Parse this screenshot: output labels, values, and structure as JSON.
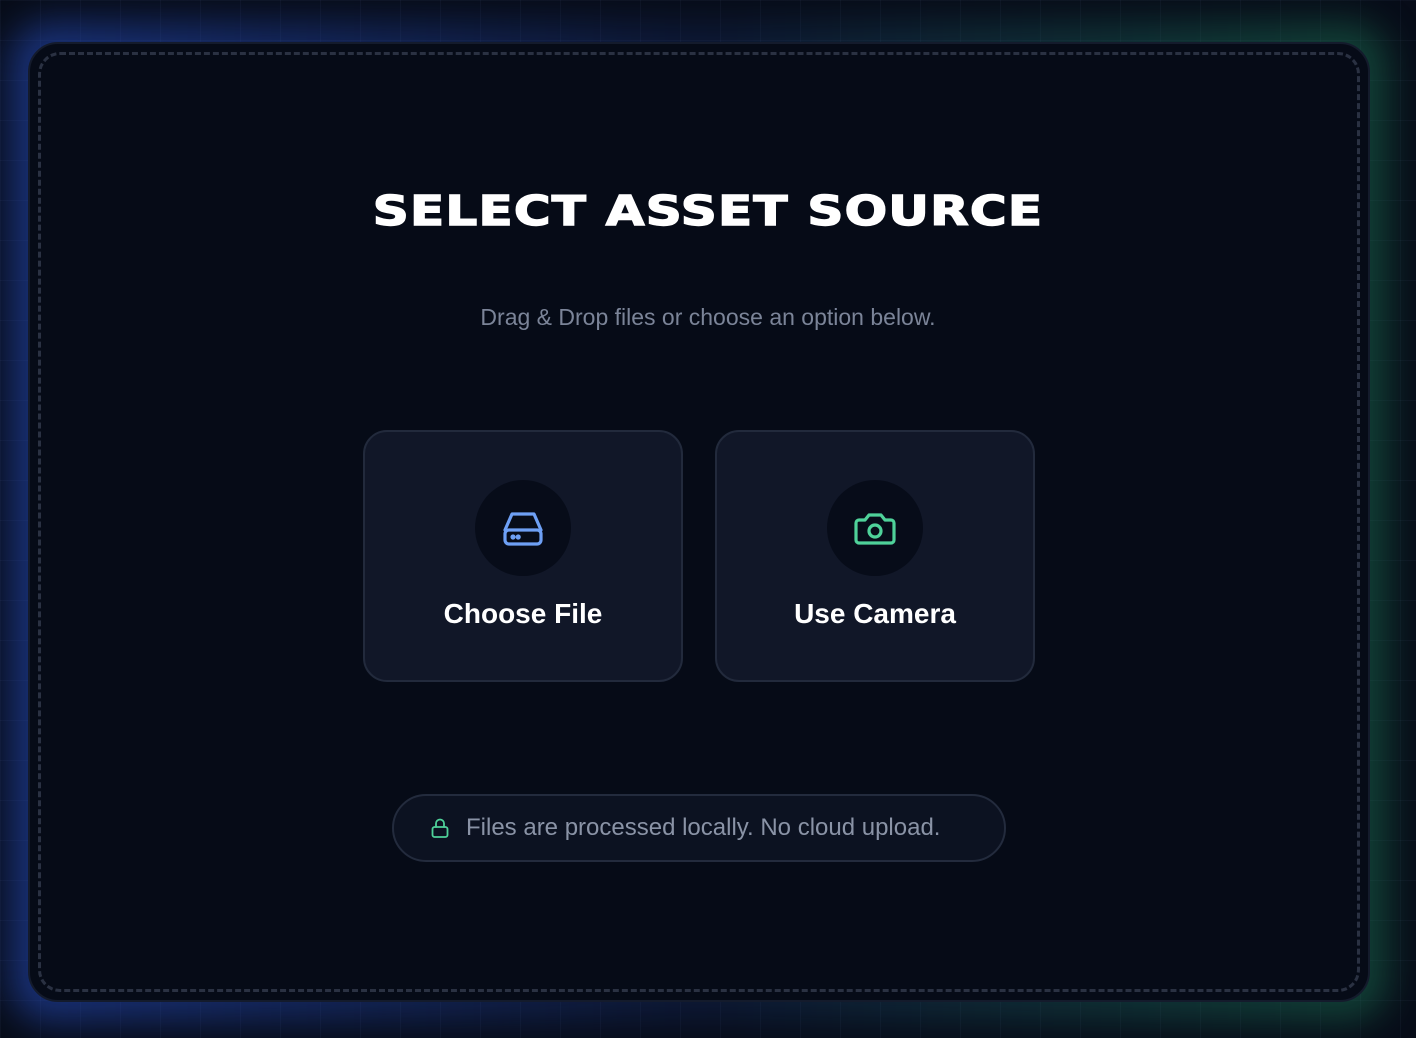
{
  "header": {
    "title": "SELECT ASSET SOURCE",
    "subtitle": "Drag & Drop files or choose an option below."
  },
  "options": [
    {
      "label": "Choose File",
      "icon": "hard-drive-icon",
      "color": "#6ea0f5"
    },
    {
      "label": "Use Camera",
      "icon": "camera-icon",
      "color": "#4fd29a"
    }
  ],
  "notice": {
    "text": "Files are processed locally. No cloud upload.",
    "icon": "lock-icon",
    "color": "#4fd29a"
  }
}
